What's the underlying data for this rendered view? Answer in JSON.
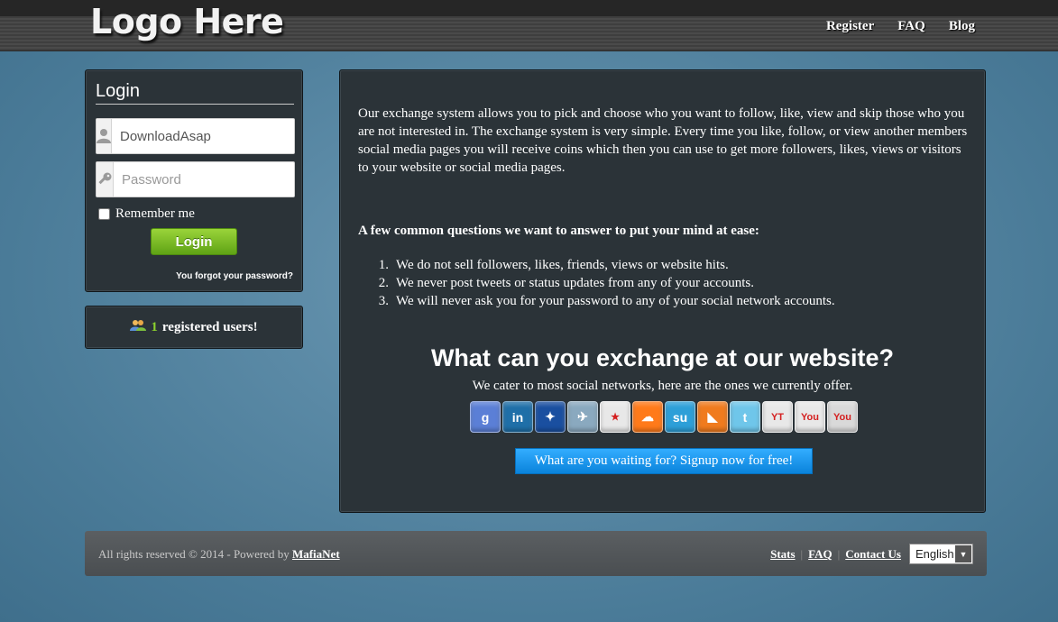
{
  "header": {
    "logo": "Logo Here",
    "nav": [
      "Register",
      "FAQ",
      "Blog"
    ]
  },
  "login": {
    "title": "Login",
    "username_value": "DownloadAsap",
    "password_placeholder": "Password",
    "remember_label": "Remember me",
    "button": "Login",
    "forgot": "You forgot your password?"
  },
  "users": {
    "count": "1",
    "label": "registered users!"
  },
  "main": {
    "intro": "Our exchange system allows you to pick and choose who you want to follow, like, view and skip those who you are not interested in. The exchange system is very simple. Every time you like, follow, or view another members social media pages you will receive coins which then you can use to get more followers, likes, views or visitors to your website or social media pages.",
    "faq_title": "A few common questions we want to answer to put your mind at ease:",
    "faq": [
      {
        "num": "1.",
        "text": "We do not sell followers, likes, friends, views or website hits."
      },
      {
        "num": "2.",
        "text": "We never post tweets or status updates from any of your accounts."
      },
      {
        "num": "3.",
        "text": "We will never ask you for your password to any of your social network accounts."
      }
    ],
    "exchange_title": "What can you exchange at our website?",
    "exchange_sub": "We cater to most social networks, here are the ones we currently offer.",
    "networks": [
      {
        "name": "google-plus-icon",
        "glyph": "g",
        "color": "#5b7fd6"
      },
      {
        "name": "linkedin-icon",
        "glyph": "in",
        "color": "#1f6fa8"
      },
      {
        "name": "myspace-icon",
        "glyph": "✦",
        "color": "#1a4fa0"
      },
      {
        "name": "twitter-bird-icon",
        "glyph": "✈",
        "color": "#8aa9bf"
      },
      {
        "name": "reverbnation-icon",
        "glyph": "★",
        "color": "#e8e8e8"
      },
      {
        "name": "soundcloud-icon",
        "glyph": "☁",
        "color": "#ff7a1a"
      },
      {
        "name": "stumbleupon-icon",
        "glyph": "su",
        "color": "#2d9fd8"
      },
      {
        "name": "rss-icon",
        "glyph": "◣",
        "color": "#f07b1e"
      },
      {
        "name": "twitter-icon",
        "glyph": "t",
        "color": "#6fc6ea"
      },
      {
        "name": "youtube-yt-icon",
        "glyph": "YT",
        "color": "#e8e8e8"
      },
      {
        "name": "youtube-icon",
        "glyph": "You",
        "color": "#e8e8e8"
      },
      {
        "name": "youtube-alt-icon",
        "glyph": "You",
        "color": "#d9d9d9"
      }
    ],
    "signup": "What are you waiting for? Signup now for free!"
  },
  "footer": {
    "copyright": "All rights reserved © 2014 - Powered by",
    "brand": "MafiaNet",
    "links": [
      "Stats",
      "FAQ",
      "Contact Us"
    ],
    "language": "English"
  }
}
